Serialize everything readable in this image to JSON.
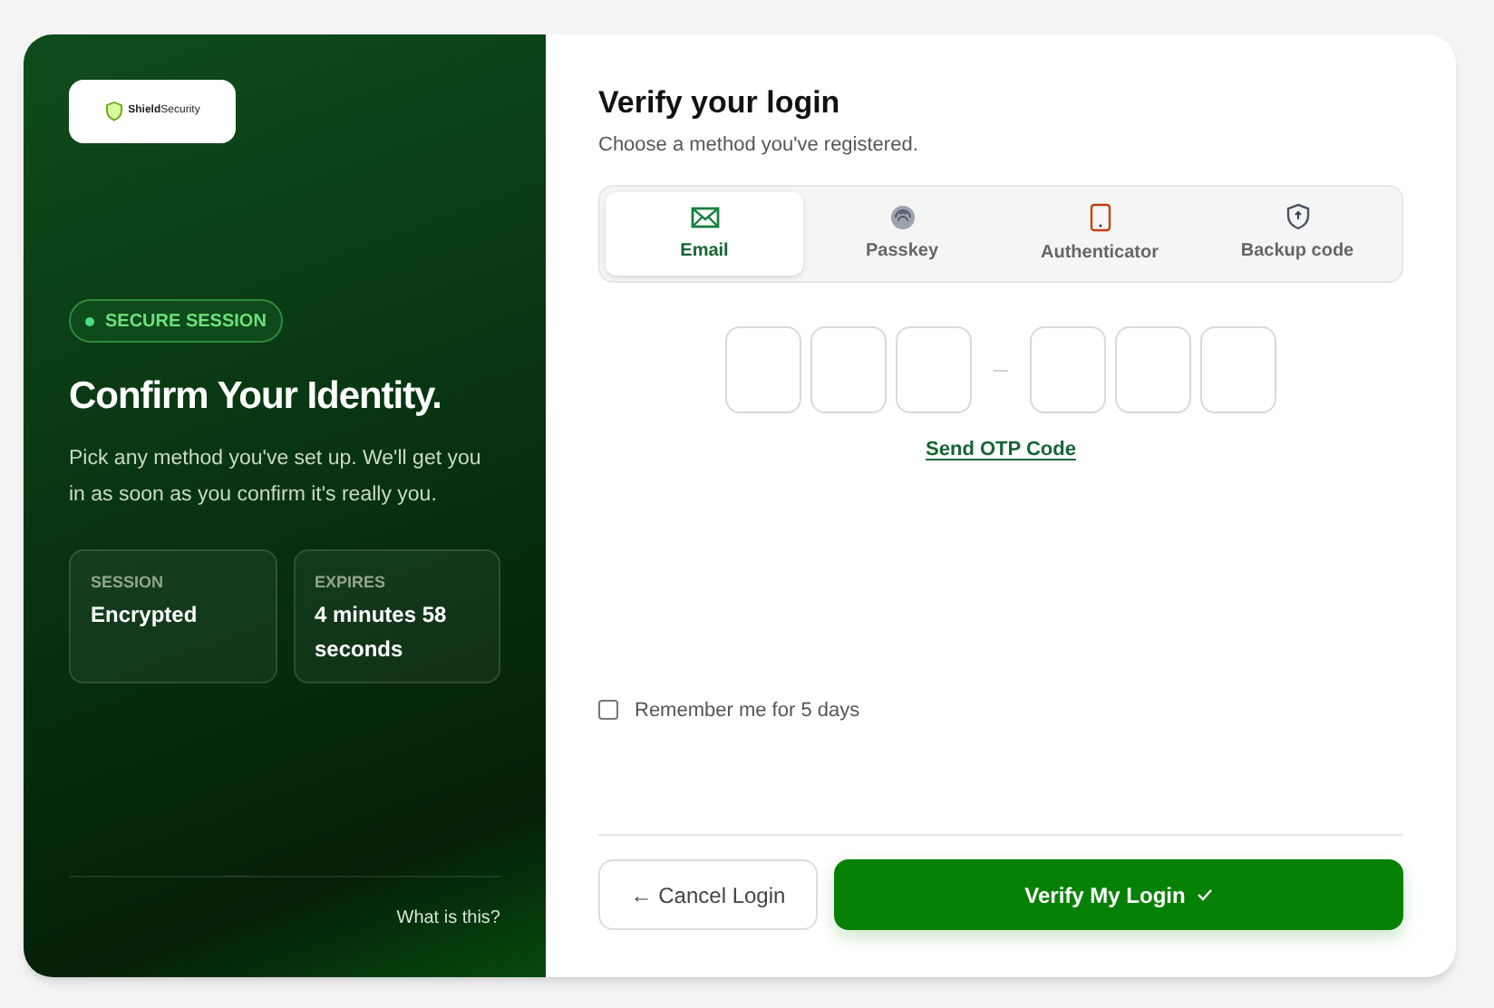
{
  "brand": {
    "logo": "**Shield**Security"
  },
  "badge": "SECURE SESSION",
  "hero": {
    "title": "Confirm Your Identity.",
    "text": "Pick any method you've set up. We'll get you in as soon as you confirm it's really you."
  },
  "info_cards": [
    {
      "label": "SESSION",
      "value": "Encrypted"
    },
    {
      "label": "EXPIRES",
      "value": "4 minutes 58 seconds"
    }
  ],
  "help_link": "What is this?",
  "form": {
    "title": "Verify your login",
    "subtitle": "Choose a method you've registered."
  },
  "tabs": [
    {
      "kind": "email",
      "label": "Email",
      "selected": true
    },
    {
      "kind": "passkey",
      "label": "Passkey",
      "selected": false
    },
    {
      "kind": "phone",
      "label": "Authenticator",
      "selected": false
    },
    {
      "kind": "shield",
      "label": "Backup code",
      "selected": false
    }
  ],
  "send_link": "Send OTP Code",
  "remember": {
    "label": "Remember me for 5 days",
    "checked": false
  },
  "buttons": {
    "cancel": "← Cancel Login",
    "verify": "Verify My Login"
  }
}
